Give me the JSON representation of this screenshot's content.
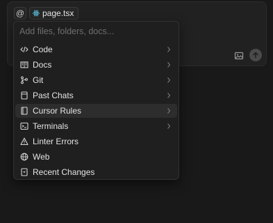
{
  "composer": {
    "at_symbol": "@",
    "file_chip": "page.tsx"
  },
  "menu": {
    "search_placeholder": "Add files, folders, docs...",
    "items": [
      {
        "label": "Code",
        "icon": "code-icon",
        "submenu": true
      },
      {
        "label": "Docs",
        "icon": "book-icon",
        "submenu": true
      },
      {
        "label": "Git",
        "icon": "git-branch-icon",
        "submenu": true
      },
      {
        "label": "Past Chats",
        "icon": "chat-icon",
        "submenu": true
      },
      {
        "label": "Cursor Rules",
        "icon": "rules-icon",
        "submenu": true,
        "active": true
      },
      {
        "label": "Terminals",
        "icon": "terminal-icon",
        "submenu": true
      },
      {
        "label": "Linter Errors",
        "icon": "warning-icon",
        "submenu": false
      },
      {
        "label": "Web",
        "icon": "globe-icon",
        "submenu": false
      },
      {
        "label": "Recent Changes",
        "icon": "history-icon",
        "submenu": false
      }
    ]
  },
  "colors": {
    "background": "#191919",
    "menu_bg": "#1f1f1f",
    "active_item_bg": "#2d2d2d",
    "react_icon": "#5ec8e8"
  }
}
